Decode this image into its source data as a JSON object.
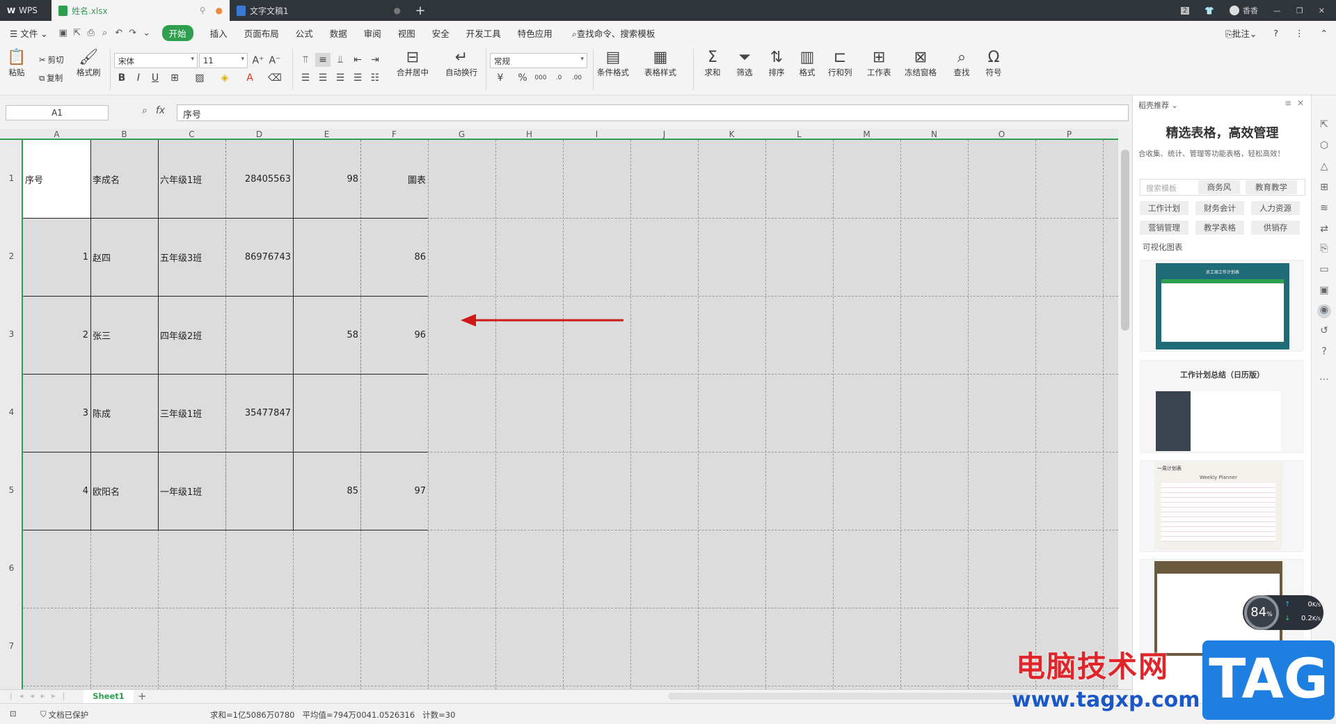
{
  "titlebar": {
    "app": "WPS",
    "tab1": "姓名.xlsx",
    "tab2": "文字文稿1",
    "badge": "2",
    "user": "香香"
  },
  "menu": {
    "file": "文件",
    "items": [
      "开始",
      "插入",
      "页面布局",
      "公式",
      "数据",
      "审阅",
      "视图",
      "安全",
      "开发工具",
      "特色应用"
    ],
    "search": "查找命令、搜索模板",
    "annot": "批注"
  },
  "ribbon": {
    "paste": "粘贴",
    "cut": "剪切",
    "copy": "复制",
    "format_painter": "格式刷",
    "font": "宋体",
    "size": "11",
    "merge": "合并居中",
    "wrap": "自动换行",
    "numfmt": "常规",
    "cond": "条件格式",
    "tstyle": "表格样式",
    "sum": "求和",
    "filter": "筛选",
    "sort": "排序",
    "fmt": "格式",
    "rowcol": "行和列",
    "sheet": "工作表",
    "freeze": "冻结窗格",
    "find": "查找",
    "symbol": "符号"
  },
  "formula": {
    "namebox": "A1",
    "fx": "fx",
    "value": "序号"
  },
  "columns": [
    "A",
    "B",
    "C",
    "D",
    "E",
    "F",
    "G",
    "H",
    "I",
    "J",
    "K",
    "L",
    "M",
    "N",
    "O",
    "P"
  ],
  "rows": [
    "1",
    "2",
    "3",
    "4",
    "5",
    "6",
    "7"
  ],
  "cells": [
    [
      "序号",
      "李成名",
      "六年级1班",
      "28405563",
      "98",
      "圖表"
    ],
    [
      "1",
      "赵四",
      "五年级3班",
      "86976743",
      "",
      "86"
    ],
    [
      "2",
      "张三",
      "四年级2班",
      "",
      "58",
      "96"
    ],
    [
      "3",
      "陈成",
      "三年级1班",
      "35477847",
      "",
      ""
    ],
    [
      "4",
      "欧阳名",
      "一年级1班",
      "",
      "85",
      "97"
    ]
  ],
  "sheetbar": {
    "sheet": "Sheet1"
  },
  "status": {
    "protect": "文档已保护",
    "stats": "求和=1亿5086万0780   平均值=794万0041.0526316   计数=30"
  },
  "panel": {
    "header": "稻壳推荐",
    "title": "精选表格，高效管理",
    "subtitle": "合收集、统计、管理等功能表格，轻松高效！",
    "search_placeholder": "搜索模板",
    "tags_top": [
      "商务风",
      "教育教学"
    ],
    "tags": [
      "工作计划",
      "财务会计",
      "人力资源",
      "营销管理",
      "教学表格",
      "供销存"
    ],
    "viz": "可视化图表",
    "card2_title": "工作计划总结（日历版）",
    "card3_title": "一周计划表",
    "card3_sub": "Weekly Planner",
    "card1_title": "员工周工作计划表"
  },
  "widget": {
    "percent": "84",
    "up": "0",
    "down": "0.2",
    "unit": "K/s"
  },
  "watermark": {
    "text": "电脑技术网",
    "url": "www.tagxp.com",
    "tag": "TAG"
  }
}
